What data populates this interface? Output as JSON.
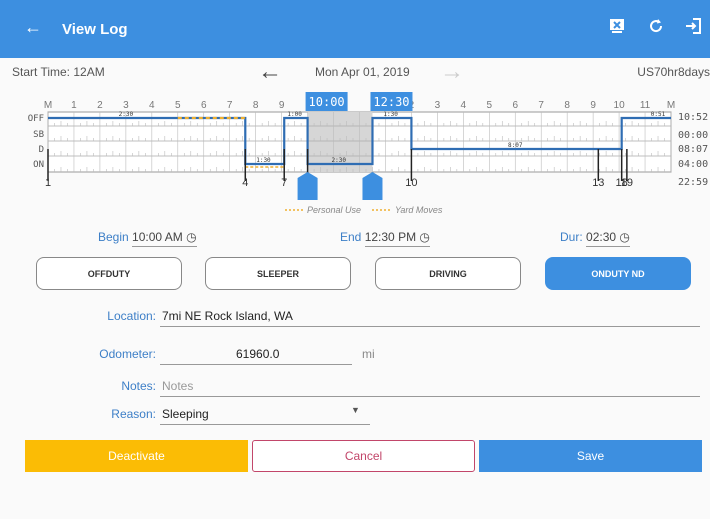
{
  "appbar": {
    "title": "View Log",
    "back_icon": "arrow-left-icon",
    "bg": "#3d8fe0"
  },
  "log": {
    "start_time": "Start Time: 12AM",
    "date": "Mon Apr 01, 2019",
    "rule": "US70hr8days"
  },
  "graph": {
    "hours_top": [
      "M",
      "1",
      "2",
      "3",
      "4",
      "5",
      "6",
      "7",
      "8",
      "9",
      "10",
      "11",
      "N",
      "1",
      "2",
      "3",
      "4",
      "5",
      "6",
      "7",
      "8",
      "9",
      "10",
      "11",
      "M"
    ],
    "rows": [
      "OFF",
      "SB",
      "D",
      "ON"
    ],
    "totals": [
      "10:52",
      "00:00",
      "08:07",
      "04:00",
      "22:59"
    ],
    "selection_start": "10:00",
    "selection_end": "12:30",
    "event_markers": [
      "1",
      "4",
      "7",
      "8",
      "10",
      "13",
      "18",
      "19"
    ],
    "segment_labels": [
      "2:30",
      "1:00",
      "1:30",
      "2:30",
      "1:30",
      "8:07",
      "0:51"
    ],
    "legend_personal": "Personal Use",
    "legend_yard": "Yard Moves"
  },
  "times": {
    "begin_label": "Begin",
    "begin_value": "10:00 AM",
    "end_label": "End",
    "end_value": "12:30 PM",
    "dur_label": "Dur:",
    "dur_value": "02:30"
  },
  "statuses": [
    "OFFDUTY",
    "SLEEPER",
    "DRIVING",
    "ONDUTY ND"
  ],
  "active_status_index": 3,
  "form": {
    "location_label": "Location:",
    "location_value": "7mi NE Rock Island, WA",
    "odometer_label": "Odometer:",
    "odometer_value": "61960.0",
    "odometer_unit": "mi",
    "notes_label": "Notes:",
    "notes_placeholder": "Notes",
    "reason_label": "Reason:",
    "reason_value": "Sleeping"
  },
  "actions": {
    "deactivate": "Deactivate",
    "cancel": "Cancel",
    "save": "Save"
  },
  "colors": {
    "deactivate": "#fbbc05",
    "cancel_border": "#c2466a",
    "save": "#3d8fe0"
  }
}
